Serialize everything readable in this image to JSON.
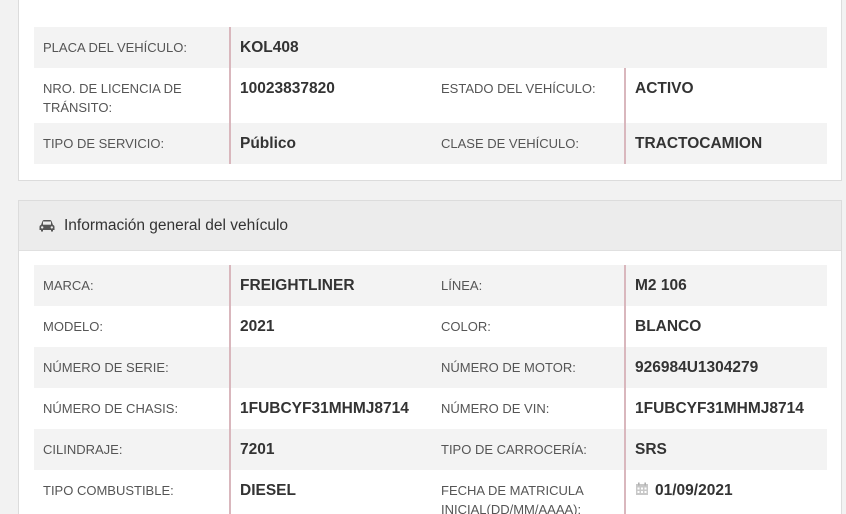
{
  "top_section": {
    "rows": [
      {
        "l1": "PLACA DEL VEHÍCULO:",
        "v1": "KOL408"
      },
      {
        "l1": "NRO. DE LICENCIA DE TRÁNSITO:",
        "v1": "10023837820",
        "l2": "ESTADO DEL VEHÍCULO:",
        "v2": "ACTIVO"
      },
      {
        "l1": "TIPO DE SERVICIO:",
        "v1": "Público",
        "l2": "CLASE DE VEHÍCULO:",
        "v2": "TRACTOCAMION"
      }
    ]
  },
  "general_section": {
    "title": "Información general del vehículo",
    "icon": "car-icon",
    "rows": [
      {
        "l1": "MARCA:",
        "v1": "FREIGHTLINER",
        "l2": "LÍNEA:",
        "v2": "M2 106"
      },
      {
        "l1": "MODELO:",
        "v1": "2021",
        "l2": "COLOR:",
        "v2": "BLANCO"
      },
      {
        "l1": "NÚMERO DE SERIE:",
        "v1": "",
        "l2": "NÚMERO DE MOTOR:",
        "v2": "926984U1304279"
      },
      {
        "l1": "NÚMERO DE CHASIS:",
        "v1": "1FUBCYF31MHMJ8714",
        "l2": "NÚMERO DE VIN:",
        "v2": "1FUBCYF31MHMJ8714"
      },
      {
        "l1": "CILINDRAJE:",
        "v1": "7201",
        "l2": "TIPO DE CARROCERÍA:",
        "v2": "SRS"
      },
      {
        "l1": "TIPO COMBUSTIBLE:",
        "v1": "DIESEL",
        "l2": "FECHA DE MATRICULA INICIAL(DD/MM/AAAA):",
        "v2": "01/09/2021",
        "v2_icon": "calendar-icon"
      }
    ]
  },
  "colors": {
    "accent_bar": "#d9b7bd",
    "row_shade": "#f3f3f3",
    "heading_bg": "#ececec"
  }
}
